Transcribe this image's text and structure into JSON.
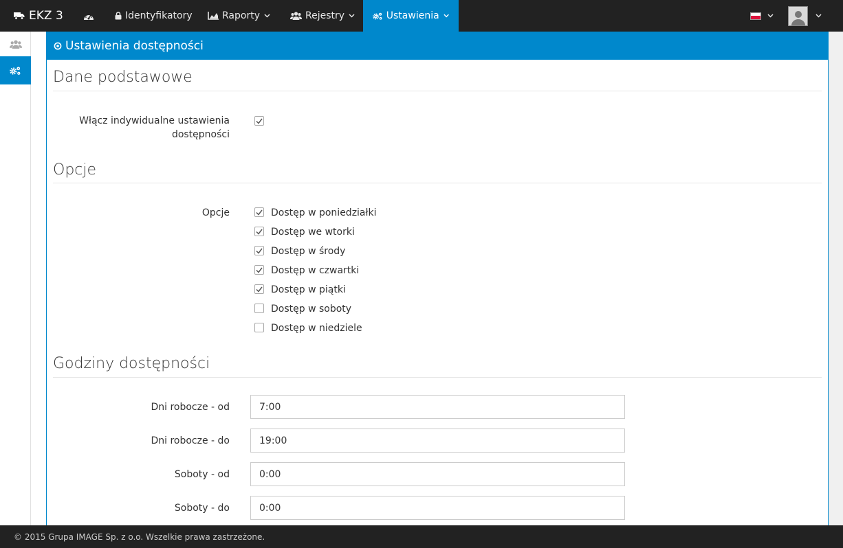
{
  "brand": {
    "name": "EKZ 3",
    "icon": "truck-icon"
  },
  "nav": [
    {
      "label": "",
      "icon": "dashboard-icon",
      "dropdown": false
    },
    {
      "label": "Identyfikatory",
      "icon": "lock-icon",
      "dropdown": false
    },
    {
      "label": "Raporty",
      "icon": "area-chart-icon",
      "dropdown": true
    },
    {
      "label": "Rejestry",
      "icon": "users-icon",
      "dropdown": true
    },
    {
      "label": "Ustawienia",
      "icon": "gears-icon",
      "dropdown": true,
      "active": true
    }
  ],
  "accent_color": "#0088cc",
  "panel": {
    "title": "Ustawienia dostępności"
  },
  "sections": {
    "basic": {
      "title": "Dane podstawowe",
      "enable_label_line1": "Włącz indywidualne ustawienia",
      "enable_label_line2": "dostępności",
      "enable_checked": true
    },
    "options": {
      "title": "Opcje",
      "label": "Opcje",
      "items": [
        {
          "label": "Dostęp w poniedziałki",
          "checked": true
        },
        {
          "label": "Dostęp we wtorki",
          "checked": true
        },
        {
          "label": "Dostęp w środy",
          "checked": true
        },
        {
          "label": "Dostęp w czwartki",
          "checked": true
        },
        {
          "label": "Dostęp w piątki",
          "checked": true
        },
        {
          "label": "Dostęp w soboty",
          "checked": false
        },
        {
          "label": "Dostęp w niedziele",
          "checked": false
        }
      ]
    },
    "hours": {
      "title": "Godziny dostępności",
      "fields": [
        {
          "label": "Dni robocze - od",
          "value": "7:00"
        },
        {
          "label": "Dni robocze - do",
          "value": "19:00"
        },
        {
          "label": "Soboty - od",
          "value": "0:00"
        },
        {
          "label": "Soboty - do",
          "value": "0:00"
        }
      ]
    }
  },
  "footer": {
    "text": "© 2015 Grupa IMAGE Sp. z o.o. Wszelkie prawa zastrzeżone."
  }
}
